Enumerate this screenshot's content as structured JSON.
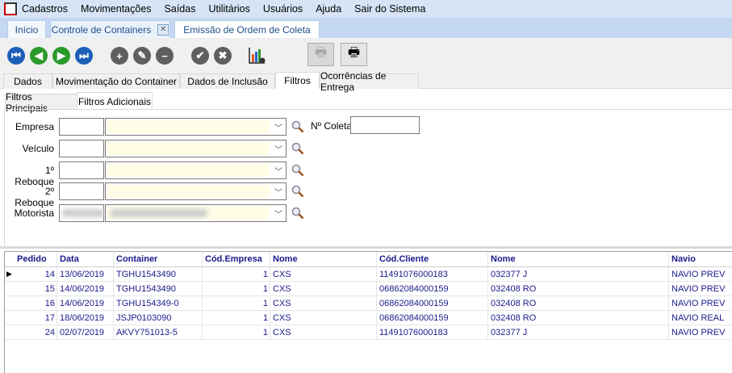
{
  "menu": [
    "Cadastros",
    "Movimentações",
    "Saídas",
    "Utilitários",
    "Usuários",
    "Ajuda",
    "Sair do Sistema"
  ],
  "doc_tabs": {
    "inicio": "Início",
    "controle": "Controle de Containers",
    "close": "⊠",
    "emissao": "Emissão de Ordem de Coleta"
  },
  "page_tabs": [
    "Dados",
    "Movimentação do Container",
    "Dados de Inclusão",
    "Filtros",
    "Ocorrências de Entrega"
  ],
  "sub_tabs": [
    "Filtros Principais",
    "Filtros Adicionais"
  ],
  "form": {
    "labels": [
      "Empresa",
      "Veículo",
      "1º Reboque",
      "2º Reboque",
      "Motorista"
    ],
    "coleta_label": "Nº Coleta",
    "coleta_value": ""
  },
  "grid": {
    "headers": [
      "Pedido",
      "Data",
      "Container",
      "Cód.Empresa",
      "Nome",
      "Cód.Cliente",
      "Nome",
      "Navio"
    ],
    "rows": [
      [
        "14",
        "13/06/2019",
        "TGHU1543490",
        "1",
        "CXS",
        "11491076000183",
        "032377  J",
        "NAVIO PREV"
      ],
      [
        "15",
        "14/06/2019",
        "TGHU1543490",
        "1",
        "CXS",
        "06862084000159",
        "032408  RO",
        "NAVIO PREV"
      ],
      [
        "16",
        "14/06/2019",
        "TGHU154349-0",
        "1",
        "CXS",
        "06862084000159",
        "032408  RO",
        "NAVIO PREV"
      ],
      [
        "17",
        "18/06/2019",
        "JSJP0103090",
        "1",
        "CXS",
        "06862084000159",
        "032408  RO",
        "NAVIO REAL"
      ],
      [
        "24",
        "02/07/2019",
        "AKVY751013-5",
        "1",
        "CXS",
        "11491076000183",
        "032377  J",
        "NAVIO PREV"
      ]
    ]
  }
}
